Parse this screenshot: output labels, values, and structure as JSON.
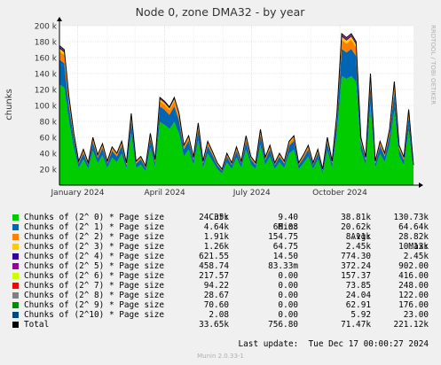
{
  "chart_data": {
    "type": "area",
    "stacked": true,
    "title": "Node 0, zone DMA32 - by year",
    "ylabel": "chunks",
    "watermark": "RRDTOOL / TOBI OETIKER",
    "ylim": [
      0,
      200000
    ],
    "y_ticks": [
      {
        "v": 20000,
        "label": "20 k"
      },
      {
        "v": 40000,
        "label": "40 k"
      },
      {
        "v": 60000,
        "label": "60 k"
      },
      {
        "v": 80000,
        "label": "80 k"
      },
      {
        "v": 100000,
        "label": "100 k"
      },
      {
        "v": 120000,
        "label": "120 k"
      },
      {
        "v": 140000,
        "label": "140 k"
      },
      {
        "v": 160000,
        "label": "160 k"
      },
      {
        "v": 180000,
        "label": "180 k"
      },
      {
        "v": 200000,
        "label": "200 k"
      }
    ],
    "x_range": [
      "2023-12-13",
      "2024-12-17"
    ],
    "x_ticks": [
      {
        "date": "2024-01-01",
        "label": "January 2024"
      },
      {
        "date": "2024-04-01",
        "label": "April 2024"
      },
      {
        "date": "2024-07-01",
        "label": "July 2024"
      },
      {
        "date": "2024-10-01",
        "label": "October 2024"
      }
    ],
    "x_minor_ticks": [
      "2024-02-01",
      "2024-03-01",
      "2024-05-01",
      "2024-06-01",
      "2024-08-01",
      "2024-09-01",
      "2024-11-01",
      "2024-12-01"
    ],
    "grid": true,
    "series_colors": [
      "#00cc00",
      "#0066b3",
      "#ff8000",
      "#ffcc00",
      "#330099",
      "#990099",
      "#ccff00",
      "#ff0000",
      "#808080",
      "#008f00",
      "#00487d"
    ],
    "total_color": "#000000",
    "x": [
      "2023-12-13",
      "2023-12-18",
      "2023-12-23",
      "2023-12-28",
      "2024-01-02",
      "2024-01-07",
      "2024-01-12",
      "2024-01-17",
      "2024-01-22",
      "2024-01-27",
      "2024-02-01",
      "2024-02-06",
      "2024-02-11",
      "2024-02-16",
      "2024-02-21",
      "2024-02-26",
      "2024-03-02",
      "2024-03-07",
      "2024-03-12",
      "2024-03-17",
      "2024-03-22",
      "2024-03-27",
      "2024-04-01",
      "2024-04-06",
      "2024-04-11",
      "2024-04-16",
      "2024-04-21",
      "2024-04-26",
      "2024-05-01",
      "2024-05-06",
      "2024-05-11",
      "2024-05-16",
      "2024-05-21",
      "2024-05-26",
      "2024-05-31",
      "2024-06-05",
      "2024-06-10",
      "2024-06-15",
      "2024-06-20",
      "2024-06-25",
      "2024-06-30",
      "2024-07-05",
      "2024-07-10",
      "2024-07-15",
      "2024-07-20",
      "2024-07-25",
      "2024-07-30",
      "2024-08-04",
      "2024-08-09",
      "2024-08-14",
      "2024-08-19",
      "2024-08-24",
      "2024-08-29",
      "2024-09-03",
      "2024-09-08",
      "2024-09-13",
      "2024-09-18",
      "2024-09-23",
      "2024-09-28",
      "2024-10-03",
      "2024-10-08",
      "2024-10-13",
      "2024-10-18",
      "2024-10-23",
      "2024-10-28",
      "2024-11-02",
      "2024-11-07",
      "2024-11-12",
      "2024-11-17",
      "2024-11-22",
      "2024-11-27",
      "2024-12-02",
      "2024-12-07",
      "2024-12-12",
      "2024-12-17"
    ],
    "totals": [
      175000,
      170000,
      110000,
      65000,
      30000,
      45000,
      28000,
      60000,
      38000,
      52000,
      30000,
      48000,
      40000,
      55000,
      28000,
      90000,
      30000,
      36000,
      24000,
      65000,
      32000,
      110000,
      105000,
      98000,
      110000,
      90000,
      50000,
      62000,
      35000,
      78000,
      30000,
      55000,
      42000,
      28000,
      20000,
      40000,
      28000,
      48000,
      30000,
      62000,
      36000,
      28000,
      70000,
      35000,
      50000,
      28000,
      40000,
      30000,
      55000,
      62000,
      28000,
      38000,
      50000,
      28000,
      45000,
      20000,
      60000,
      30000,
      90000,
      190000,
      185000,
      190000,
      180000,
      60000,
      35000,
      140000,
      30000,
      55000,
      40000,
      70000,
      130000,
      50000,
      35000,
      95000,
      25000
    ],
    "green_share": 0.72,
    "series": [
      {
        "name": "Chunks of (2^ 0) * Page size",
        "cur": "24.35k",
        "min": "9.40",
        "avg": "38.81k",
        "max": "130.73k"
      },
      {
        "name": "Chunks of (2^ 1) * Page size",
        "cur": "4.64k",
        "min": "66.08",
        "avg": "20.62k",
        "max": "64.64k"
      },
      {
        "name": "Chunks of (2^ 2) * Page size",
        "cur": "1.91k",
        "min": "154.75",
        "avg": "8.11k",
        "max": "28.82k"
      },
      {
        "name": "Chunks of (2^ 3) * Page size",
        "cur": "1.26k",
        "min": "64.75",
        "avg": "2.45k",
        "max": "10.13k"
      },
      {
        "name": "Chunks of (2^ 4) * Page size",
        "cur": "621.55",
        "min": "14.50",
        "avg": "774.30",
        "max": "2.45k"
      },
      {
        "name": "Chunks of (2^ 5) * Page size",
        "cur": "458.74",
        "min": "83.33m",
        "avg": "372.24",
        "max": "902.00"
      },
      {
        "name": "Chunks of (2^ 6) * Page size",
        "cur": "217.57",
        "min": "0.00",
        "avg": "157.37",
        "max": "416.00"
      },
      {
        "name": "Chunks of (2^ 7) * Page size",
        "cur": "94.22",
        "min": "0.00",
        "avg": "73.85",
        "max": "248.00"
      },
      {
        "name": "Chunks of (2^ 8) * Page size",
        "cur": "28.67",
        "min": "0.00",
        "avg": "24.04",
        "max": "122.00"
      },
      {
        "name": "Chunks of (2^ 9) * Page size",
        "cur": "70.60",
        "min": "0.00",
        "avg": "62.91",
        "max": "176.00"
      },
      {
        "name": "Chunks of (2^10) * Page size",
        "cur": "2.08",
        "min": "0.00",
        "avg": "5.92",
        "max": "23.00"
      },
      {
        "name": "Total",
        "cur": "33.65k",
        "min": "756.80",
        "avg": "71.47k",
        "max": "221.12k"
      }
    ]
  },
  "legend_headers": {
    "cur": "Cur:",
    "min": "Min:",
    "avg": "Avg:",
    "max": "Max:"
  },
  "last_update": "Last update:  Tue Dec 17 00:00:27 2024",
  "footer": "Munin 2.0.33-1"
}
